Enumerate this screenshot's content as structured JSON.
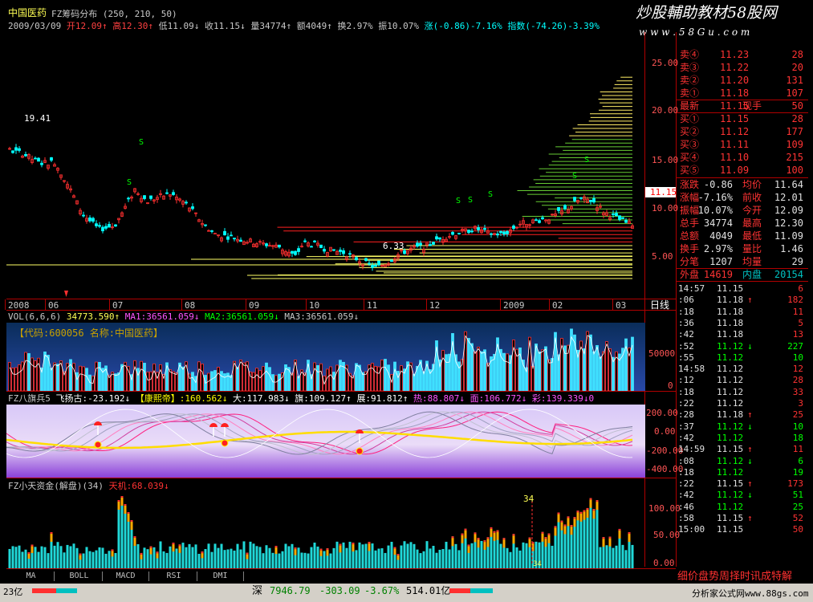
{
  "header": {
    "stock_name": "中国医药",
    "indicator": "FZ筹码分布 (250, 210, 50)",
    "watermark": "炒股輔助教材58股网",
    "watermark_url": "w w w . 5 8 G u . c o m",
    "quote_line_date": "2009/03/09",
    "quote_open": "开12.09↑",
    "quote_high": "高12.30↑",
    "quote_low": "低11.09↓",
    "quote_close": "收11.15↓",
    "quote_volume": "量34774↑",
    "quote_amount": "额4049↑",
    "quote_turnover": "换2.97%",
    "quote_amplitude": "振10.07%",
    "quote_change": "涨(-0.86)-7.16%",
    "quote_index": "指数(-74.26)-3.39%"
  },
  "price_chart": {
    "y_axis": [
      "25.00",
      "20.00",
      "15.00",
      "10.00",
      "5.00"
    ],
    "last_price": "11.15",
    "annot_high": "19.41",
    "annot_low": "6.33",
    "x_labels": [
      "2008",
      "06",
      "07",
      "08",
      "09",
      "10",
      "11",
      "12",
      "2009",
      "02",
      "03"
    ],
    "period": "日线"
  },
  "volume_chart": {
    "title_label": "VOL(6,6,6)",
    "title_vol": "34773.590↑",
    "title_ma1": "MA1:36561.059↓",
    "title_ma2": "MA2:36561.059↓",
    "title_ma3": "MA3:36561.059↓",
    "code_tag": "【代码:600056 名称:中国医药】",
    "y_axis": [
      "50000",
      "0"
    ]
  },
  "flag_chart": {
    "title_label": "FZ八旗兵5",
    "title_a": "飞扬古:-23.192↓",
    "title_b": "【康熙帝】:160.562↓",
    "title_c": "大:117.983↓",
    "title_d": "旗:109.127↑",
    "title_e": "展:91.812↑",
    "title_f": "热:88.807↓",
    "title_g": "面:106.772↓",
    "title_h": "彩:139.339↓0",
    "y_axis": [
      "200.00",
      "0.00",
      "-200.00",
      "-400.00"
    ]
  },
  "fund_chart": {
    "title_label": "FZ小天资金(解盘)(34)",
    "title_value": "天机:68.039↓",
    "y_axis": [
      "100.00",
      "50.00",
      "0.00"
    ],
    "marker_top": "34",
    "marker_bottom": "34"
  },
  "tabs": [
    "MA",
    "BOLL",
    "MACD",
    "RSI",
    "DMI"
  ],
  "status": {
    "left": "23亿",
    "market": "深",
    "index_value": "7946.79",
    "index_change": "-303.09",
    "index_pct": "-3.67%",
    "index_amount": "514.01亿",
    "website": "分析家公式网www.88gs.com"
  },
  "order_book": {
    "asks": [
      {
        "label": "卖④",
        "price": "11.23",
        "vol": "28"
      },
      {
        "label": "卖③",
        "price": "11.22",
        "vol": "20"
      },
      {
        "label": "卖②",
        "price": "11.20",
        "vol": "131"
      },
      {
        "label": "卖①",
        "price": "11.18",
        "vol": "107"
      }
    ],
    "last": {
      "label": "最新",
      "price": "11.15",
      "tag": "现手",
      "vol": "50"
    },
    "bids": [
      {
        "label": "买①",
        "price": "11.15",
        "vol": "28"
      },
      {
        "label": "买②",
        "price": "11.12",
        "vol": "177"
      },
      {
        "label": "买③",
        "price": "11.11",
        "vol": "109"
      },
      {
        "label": "买④",
        "price": "11.10",
        "vol": "215"
      },
      {
        "label": "买⑤",
        "price": "11.09",
        "vol": "100"
      }
    ]
  },
  "stats": [
    {
      "l1": "涨跌",
      "v1": "-0.86",
      "l2": "均价",
      "v2": "11.64"
    },
    {
      "l1": "涨幅",
      "v1": "-7.16%",
      "l2": "前收",
      "v2": "12.01"
    },
    {
      "l1": "振幅",
      "v1": "10.07%",
      "l2": "今开",
      "v2": "12.09"
    },
    {
      "l1": "总手",
      "v1": "34774",
      "l2": "最高",
      "v2": "12.30"
    },
    {
      "l1": "总额",
      "v1": "4049",
      "l2": "最低",
      "v2": "11.09"
    },
    {
      "l1": "换手",
      "v1": "2.97%",
      "l2": "量比",
      "v2": "1.46"
    },
    {
      "l1": "分笔",
      "v1": "1207",
      "l2": "均量",
      "v2": "29"
    }
  ],
  "outer_inner": {
    "outer_label": "外盘",
    "outer": "14619",
    "inner_label": "内盘",
    "inner": "20154"
  },
  "ticks": [
    {
      "time": "14:57",
      "price": "11.15",
      "arrow": "",
      "vol": "6",
      "color": "#ff3333"
    },
    {
      "time": ":06",
      "price": "11.18",
      "arrow": "↑",
      "vol": "182",
      "color": "#ff3333"
    },
    {
      "time": ":18",
      "price": "11.18",
      "arrow": "",
      "vol": "11",
      "color": "#ff3333"
    },
    {
      "time": ":36",
      "price": "11.18",
      "arrow": "",
      "vol": "5",
      "color": "#ff3333"
    },
    {
      "time": ":42",
      "price": "11.18",
      "arrow": "",
      "vol": "13",
      "color": "#ff3333"
    },
    {
      "time": ":52",
      "price": "11.12",
      "arrow": "↓",
      "vol": "227",
      "color": "#00ff00"
    },
    {
      "time": ":55",
      "price": "11.12",
      "arrow": "",
      "vol": "10",
      "color": "#00ff00"
    },
    {
      "time": "14:58",
      "price": "11.12",
      "arrow": "",
      "vol": "12",
      "color": "#ff3333"
    },
    {
      "time": ":12",
      "price": "11.12",
      "arrow": "",
      "vol": "28",
      "color": "#ff3333"
    },
    {
      "time": ":18",
      "price": "11.12",
      "arrow": "",
      "vol": "33",
      "color": "#ff3333"
    },
    {
      "time": ":22",
      "price": "11.12",
      "arrow": "",
      "vol": "3",
      "color": "#ff3333"
    },
    {
      "time": ":28",
      "price": "11.18",
      "arrow": "↑",
      "vol": "25",
      "color": "#ff3333"
    },
    {
      "time": ":37",
      "price": "11.12",
      "arrow": "↓",
      "vol": "10",
      "color": "#00ff00"
    },
    {
      "time": ":42",
      "price": "11.12",
      "arrow": "",
      "vol": "18",
      "color": "#00ff00"
    },
    {
      "time": "14:59",
      "price": "11.15",
      "arrow": "↑",
      "vol": "11",
      "color": "#ff3333"
    },
    {
      "time": ":08",
      "price": "11.12",
      "arrow": "↓",
      "vol": "6",
      "color": "#00ff00"
    },
    {
      "time": ":18",
      "price": "11.12",
      "arrow": "",
      "vol": "19",
      "color": "#00ff00"
    },
    {
      "time": ":22",
      "price": "11.15",
      "arrow": "↑",
      "vol": "173",
      "color": "#ff3333"
    },
    {
      "time": ":42",
      "price": "11.12",
      "arrow": "↓",
      "vol": "51",
      "color": "#00ff00"
    },
    {
      "time": ":46",
      "price": "11.12",
      "arrow": "",
      "vol": "25",
      "color": "#00ff00"
    },
    {
      "time": ":58",
      "price": "11.15",
      "arrow": "↑",
      "vol": "52",
      "color": "#ff3333"
    },
    {
      "time": "15:00",
      "price": "11.15",
      "arrow": "",
      "vol": "50",
      "color": "#ff3333"
    }
  ],
  "right_footer": "细价盘势周择时讯成特解",
  "colors": {
    "up": "#ff3333",
    "down": "#00ffff",
    "text_cyan": "#00c0ff",
    "grid_red": "#b00000",
    "ma_yellow": "#ffff00"
  }
}
